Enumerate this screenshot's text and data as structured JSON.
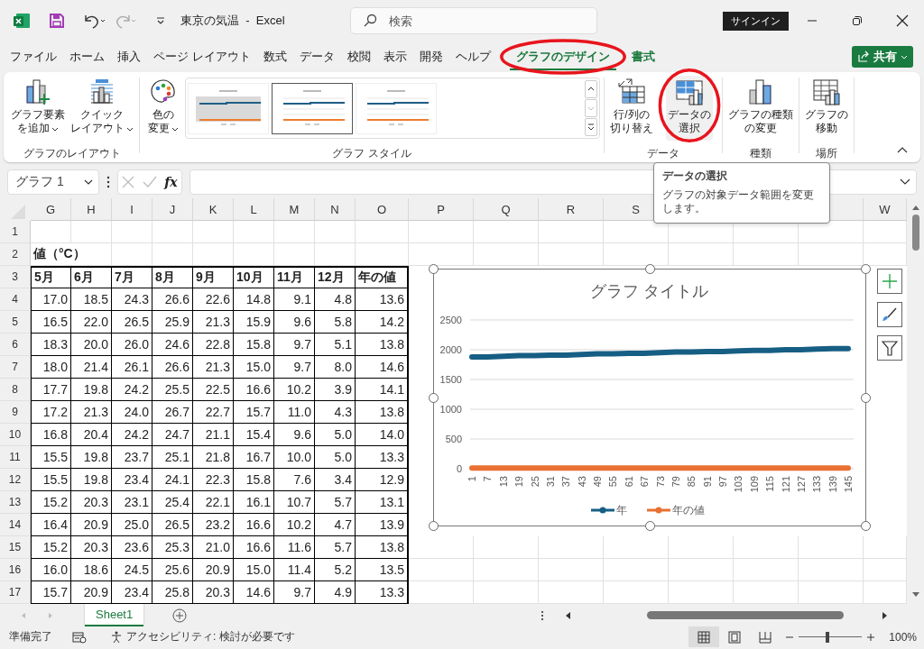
{
  "window": {
    "title": "東京の気温  -  Excel",
    "search_placeholder": "検索",
    "sign_in": "サインイン"
  },
  "tabs": [
    {
      "label": "ファイル",
      "selected": false,
      "contextual": false,
      "circled": false
    },
    {
      "label": "ホーム",
      "selected": false,
      "contextual": false,
      "circled": false
    },
    {
      "label": "挿入",
      "selected": false,
      "contextual": false,
      "circled": false
    },
    {
      "label": "ページ レイアウト",
      "selected": false,
      "contextual": false,
      "circled": false
    },
    {
      "label": "数式",
      "selected": false,
      "contextual": false,
      "circled": false
    },
    {
      "label": "データ",
      "selected": false,
      "contextual": false,
      "circled": false
    },
    {
      "label": "校閲",
      "selected": false,
      "contextual": false,
      "circled": false
    },
    {
      "label": "表示",
      "selected": false,
      "contextual": false,
      "circled": false
    },
    {
      "label": "開発",
      "selected": false,
      "contextual": false,
      "circled": false
    },
    {
      "label": "ヘルプ",
      "selected": false,
      "contextual": false,
      "circled": false
    },
    {
      "label": "グラフのデザイン",
      "selected": true,
      "contextual": true,
      "circled": true
    },
    {
      "label": "書式",
      "selected": false,
      "contextual": true,
      "circled": false
    }
  ],
  "share_button": "共有",
  "ribbon": [
    {
      "label": "グラフのレイアウト",
      "buttons": [
        {
          "kind": "add-element",
          "lines": [
            "グラフ要素",
            "を追加"
          ],
          "dropdown": true,
          "hovered": false,
          "circled": false
        },
        {
          "kind": "quick-layout",
          "lines": [
            "クイック",
            "レイアウト"
          ],
          "dropdown": true,
          "hovered": false,
          "circled": false
        }
      ]
    },
    {
      "label": "グラフ スタイル",
      "buttons": [
        {
          "kind": "colors",
          "lines": [
            "色の",
            "変更"
          ],
          "dropdown": true,
          "hovered": false,
          "circled": false
        }
      ],
      "gallery": [
        {
          "kind": "shaded",
          "selected": false
        },
        {
          "kind": "plain",
          "selected": true
        },
        {
          "kind": "plain",
          "selected": false
        }
      ]
    },
    {
      "label": "データ",
      "buttons": [
        {
          "kind": "switch",
          "lines": [
            "行/列の",
            "切り替え"
          ],
          "dropdown": false,
          "hovered": false,
          "circled": false
        },
        {
          "kind": "select-data",
          "lines": [
            "データの",
            "選択"
          ],
          "dropdown": false,
          "hovered": true,
          "circled": true
        }
      ]
    },
    {
      "label": "種類",
      "buttons": [
        {
          "kind": "change-type",
          "lines": [
            "グラフの種類",
            "の変更"
          ],
          "dropdown": false,
          "hovered": false,
          "circled": false
        }
      ]
    },
    {
      "label": "場所",
      "buttons": [
        {
          "kind": "move",
          "lines": [
            "グラフの",
            "移動"
          ],
          "dropdown": false,
          "hovered": false,
          "circled": false
        }
      ]
    }
  ],
  "tooltip": {
    "title": "データの選択",
    "text": "グラフの対象データ範囲を変更します。"
  },
  "formula_bar": {
    "name_box": "グラフ 1",
    "fx": "fx"
  },
  "sheet": {
    "column_headers": [
      "G",
      "H",
      "I",
      "J",
      "K",
      "L",
      "M",
      "N",
      "O",
      "P",
      "Q",
      "R",
      "S",
      "W"
    ],
    "row_numbers": [
      "1",
      "2",
      "3",
      "4",
      "5",
      "6",
      "7",
      "8",
      "9",
      "10",
      "11",
      "12",
      "13",
      "14",
      "15",
      "16",
      "17"
    ],
    "title_cell": "値（°C）",
    "table": {
      "header": [
        "5月",
        "6月",
        "7月",
        "8月",
        "9月",
        "10月",
        "11月",
        "12月",
        "年の値"
      ],
      "rows": [
        [
          "17.0",
          "18.5",
          "24.3",
          "26.6",
          "22.6",
          "14.8",
          "9.1",
          "4.8",
          "13.6"
        ],
        [
          "16.5",
          "22.0",
          "26.5",
          "25.9",
          "21.3",
          "15.9",
          "9.6",
          "5.8",
          "14.2"
        ],
        [
          "18.3",
          "20.0",
          "26.0",
          "24.6",
          "22.8",
          "15.8",
          "9.7",
          "5.1",
          "13.8"
        ],
        [
          "18.0",
          "21.4",
          "26.1",
          "26.6",
          "21.3",
          "15.0",
          "9.7",
          "8.0",
          "14.6"
        ],
        [
          "17.7",
          "19.8",
          "24.2",
          "25.5",
          "22.5",
          "16.6",
          "10.2",
          "3.9",
          "14.1"
        ],
        [
          "17.2",
          "21.3",
          "24.0",
          "26.7",
          "22.7",
          "15.7",
          "11.0",
          "4.3",
          "13.8"
        ],
        [
          "16.8",
          "20.4",
          "24.2",
          "24.7",
          "21.1",
          "15.4",
          "9.6",
          "5.0",
          "14.0"
        ],
        [
          "15.5",
          "19.8",
          "23.7",
          "25.1",
          "21.8",
          "16.7",
          "10.0",
          "5.0",
          "13.3"
        ],
        [
          "15.5",
          "19.8",
          "23.4",
          "24.1",
          "22.3",
          "15.8",
          "7.6",
          "3.4",
          "12.9"
        ],
        [
          "15.2",
          "20.3",
          "23.1",
          "25.4",
          "22.1",
          "16.1",
          "10.7",
          "5.7",
          "13.1"
        ],
        [
          "16.4",
          "20.9",
          "25.0",
          "26.5",
          "23.2",
          "16.6",
          "10.2",
          "4.7",
          "13.9"
        ],
        [
          "15.2",
          "20.3",
          "23.6",
          "25.3",
          "21.0",
          "16.6",
          "11.6",
          "5.7",
          "13.8"
        ],
        [
          "16.0",
          "18.6",
          "24.5",
          "25.6",
          "20.9",
          "15.0",
          "11.4",
          "5.2",
          "13.5"
        ],
        [
          "15.7",
          "20.9",
          "23.4",
          "25.8",
          "20.3",
          "14.6",
          "9.7",
          "4.9",
          "13.3"
        ]
      ]
    }
  },
  "chart": {
    "chart_data": {
      "type": "line",
      "title": "グラフ タイトル",
      "categories": [
        "1",
        "7",
        "13",
        "19",
        "25",
        "31",
        "37",
        "43",
        "49",
        "55",
        "61",
        "67",
        "73",
        "79",
        "85",
        "91",
        "97",
        "103",
        "109",
        "115",
        "121",
        "127",
        "133",
        "139",
        "145"
      ],
      "series": [
        {
          "name": "年",
          "color": "#175e84",
          "values": [
            1880,
            1880,
            1890,
            1900,
            1900,
            1910,
            1910,
            1920,
            1930,
            1930,
            1940,
            1940,
            1950,
            1960,
            1960,
            1970,
            1970,
            1980,
            1990,
            1990,
            2000,
            2000,
            2010,
            2020,
            2020
          ]
        },
        {
          "name": "年の値",
          "color": "#e97132",
          "values": [
            10,
            10,
            10,
            10,
            10,
            10,
            10,
            10,
            10,
            10,
            10,
            10,
            10,
            10,
            10,
            10,
            10,
            10,
            10,
            10,
            10,
            10,
            10,
            10,
            10
          ]
        }
      ],
      "ylim": [
        0,
        2500
      ],
      "yticks": [
        0,
        500,
        1000,
        1500,
        2000,
        2500
      ],
      "grid": true,
      "legend": true
    }
  },
  "sheet_tabs": [
    {
      "label": "Sheet1",
      "selected": true
    }
  ],
  "status_bar": {
    "ready": "準備完了",
    "accessibility": "アクセシビリティ: 検討が必要です",
    "views": [
      {
        "kind": "normal",
        "selected": true
      },
      {
        "kind": "page-layout",
        "selected": false
      },
      {
        "kind": "page-break",
        "selected": false
      }
    ],
    "zoom": {
      "level": 0.45,
      "reading": "100%"
    }
  }
}
